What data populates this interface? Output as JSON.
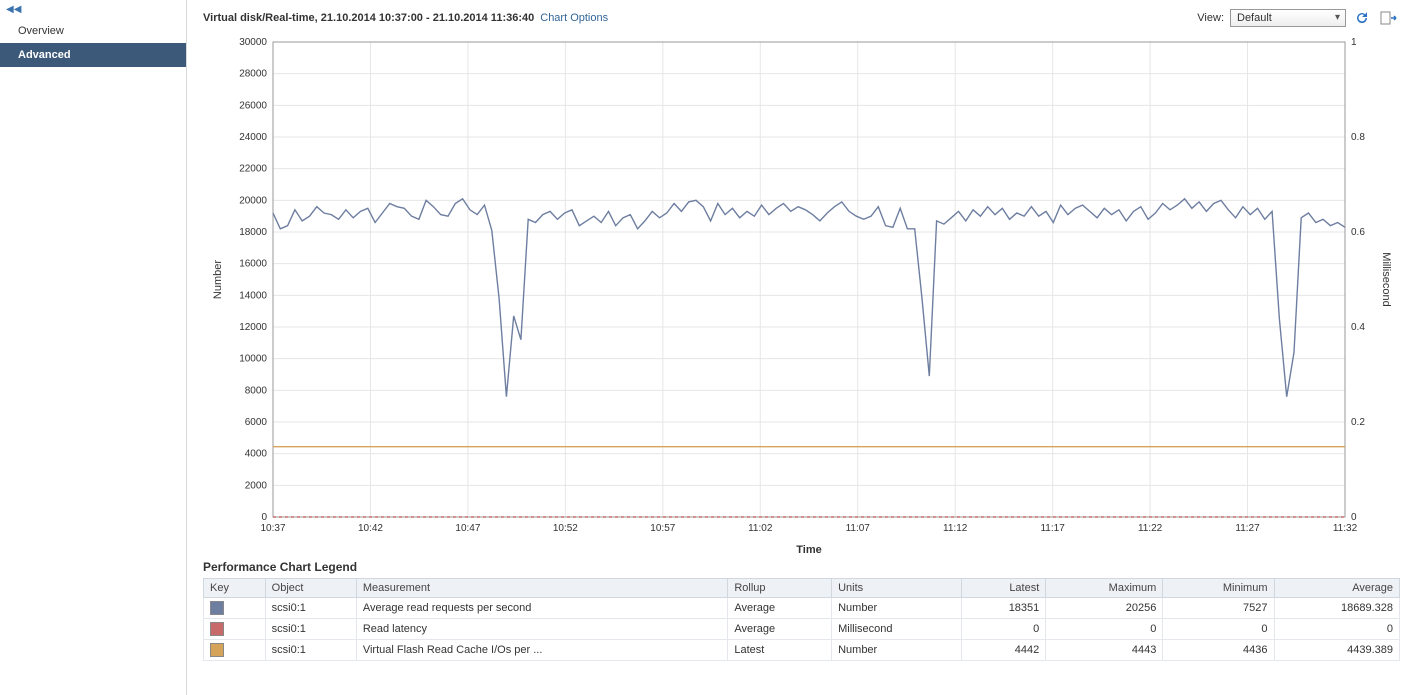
{
  "sidebar": {
    "collapse_glyph": "◀◀",
    "items": [
      {
        "label": "Overview",
        "active": false
      },
      {
        "label": "Advanced",
        "active": true
      }
    ]
  },
  "header": {
    "title": "Virtual disk/Real-time, 21.10.2014 10:37:00 - 21.10.2014 11:36:40",
    "chart_options": "Chart Options",
    "view_label": "View:",
    "view_value": "Default"
  },
  "chart_data": {
    "type": "line",
    "xlabel": "Time",
    "ylabel_left": "Number",
    "ylabel_right": "Millisecond",
    "x_categories": [
      "10:37",
      "10:42",
      "10:47",
      "10:52",
      "10:57",
      "11:02",
      "11:07",
      "11:12",
      "11:17",
      "11:22",
      "11:27",
      "11:32"
    ],
    "y_left": {
      "min": 0,
      "max": 30000,
      "step": 2000
    },
    "y_right": {
      "min": 0,
      "max": 1,
      "step": 0.2
    },
    "series": [
      {
        "name": "Average read requests per second",
        "color": "#6e7ea0",
        "axis": "left",
        "style": "solid",
        "values": [
          19200,
          18200,
          18400,
          19400,
          18700,
          19000,
          19600,
          19200,
          19100,
          18800,
          19400,
          18900,
          19300,
          19500,
          18600,
          19200,
          19800,
          19600,
          19500,
          19000,
          18800,
          20000,
          19600,
          19100,
          19000,
          19800,
          20100,
          19400,
          19100,
          19700,
          18100,
          13800,
          7600,
          12700,
          11200,
          18800,
          18600,
          19100,
          19300,
          18800,
          19200,
          19400,
          18400,
          18700,
          19000,
          18600,
          19300,
          18400,
          18900,
          19100,
          18200,
          18700,
          19300,
          18900,
          19200,
          19800,
          19300,
          19900,
          20000,
          19600,
          18700,
          19800,
          19100,
          19500,
          18900,
          19300,
          19000,
          19700,
          19100,
          19500,
          19800,
          19300,
          19600,
          19400,
          19100,
          18700,
          19200,
          19600,
          19900,
          19300,
          19000,
          18800,
          19000,
          19600,
          18400,
          18300,
          19500,
          18200,
          18200,
          13800,
          8900,
          18700,
          18500,
          18900,
          19300,
          18700,
          19400,
          19000,
          19600,
          19100,
          19500,
          18800,
          19200,
          19000,
          19600,
          19000,
          19300,
          18600,
          19700,
          19100,
          19500,
          19700,
          19300,
          18900,
          19500,
          19100,
          19400,
          18700,
          19300,
          19600,
          18800,
          19200,
          19800,
          19400,
          19700,
          20100,
          19500,
          19900,
          19300,
          19800,
          20000,
          19400,
          18900,
          19600,
          19100,
          19500,
          18800,
          19300,
          12500,
          7600,
          10400,
          18900,
          19200,
          18600,
          18800,
          18400,
          18600,
          18300
        ]
      },
      {
        "name": "Virtual Flash Read Cache I/Os per second",
        "color": "#d6a35a",
        "axis": "left",
        "style": "solid",
        "values_constant": 4440,
        "count": 148
      },
      {
        "name": "Read latency",
        "color": "#c96a6a",
        "axis": "right",
        "style": "dashed",
        "values_constant": 0,
        "count": 148
      }
    ]
  },
  "legend": {
    "title": "Performance Chart Legend",
    "headers": [
      "Key",
      "Object",
      "Measurement",
      "Rollup",
      "Units",
      "Latest",
      "Maximum",
      "Minimum",
      "Average"
    ],
    "rows": [
      {
        "color": "#6e7ea0",
        "object": "scsi0:1",
        "measurement": "Average read requests per second",
        "rollup": "Average",
        "units": "Number",
        "latest": "18351",
        "maximum": "20256",
        "minimum": "7527",
        "average": "18689.328"
      },
      {
        "color": "#c96a6a",
        "object": "scsi0:1",
        "measurement": "Read latency",
        "rollup": "Average",
        "units": "Millisecond",
        "latest": "0",
        "maximum": "0",
        "minimum": "0",
        "average": "0"
      },
      {
        "color": "#d6a35a",
        "object": "scsi0:1",
        "measurement": "Virtual Flash Read Cache I/Os per ...",
        "rollup": "Latest",
        "units": "Number",
        "latest": "4442",
        "maximum": "4443",
        "minimum": "4436",
        "average": "4439.389"
      }
    ]
  }
}
